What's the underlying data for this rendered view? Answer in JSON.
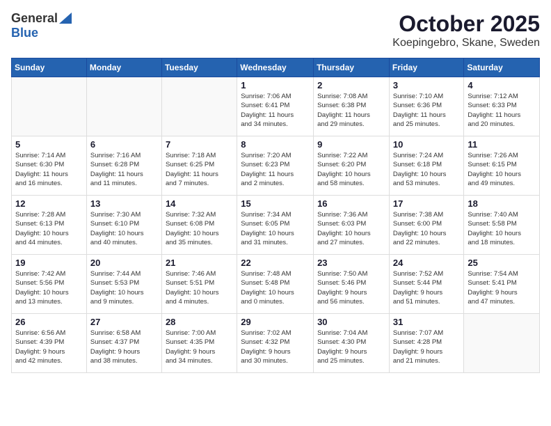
{
  "header": {
    "logo_general": "General",
    "logo_blue": "Blue",
    "month": "October 2025",
    "location": "Koepingebro, Skane, Sweden"
  },
  "weekdays": [
    "Sunday",
    "Monday",
    "Tuesday",
    "Wednesday",
    "Thursday",
    "Friday",
    "Saturday"
  ],
  "weeks": [
    [
      {
        "day": "",
        "info": ""
      },
      {
        "day": "",
        "info": ""
      },
      {
        "day": "",
        "info": ""
      },
      {
        "day": "1",
        "info": "Sunrise: 7:06 AM\nSunset: 6:41 PM\nDaylight: 11 hours\nand 34 minutes."
      },
      {
        "day": "2",
        "info": "Sunrise: 7:08 AM\nSunset: 6:38 PM\nDaylight: 11 hours\nand 29 minutes."
      },
      {
        "day": "3",
        "info": "Sunrise: 7:10 AM\nSunset: 6:36 PM\nDaylight: 11 hours\nand 25 minutes."
      },
      {
        "day": "4",
        "info": "Sunrise: 7:12 AM\nSunset: 6:33 PM\nDaylight: 11 hours\nand 20 minutes."
      }
    ],
    [
      {
        "day": "5",
        "info": "Sunrise: 7:14 AM\nSunset: 6:30 PM\nDaylight: 11 hours\nand 16 minutes."
      },
      {
        "day": "6",
        "info": "Sunrise: 7:16 AM\nSunset: 6:28 PM\nDaylight: 11 hours\nand 11 minutes."
      },
      {
        "day": "7",
        "info": "Sunrise: 7:18 AM\nSunset: 6:25 PM\nDaylight: 11 hours\nand 7 minutes."
      },
      {
        "day": "8",
        "info": "Sunrise: 7:20 AM\nSunset: 6:23 PM\nDaylight: 11 hours\nand 2 minutes."
      },
      {
        "day": "9",
        "info": "Sunrise: 7:22 AM\nSunset: 6:20 PM\nDaylight: 10 hours\nand 58 minutes."
      },
      {
        "day": "10",
        "info": "Sunrise: 7:24 AM\nSunset: 6:18 PM\nDaylight: 10 hours\nand 53 minutes."
      },
      {
        "day": "11",
        "info": "Sunrise: 7:26 AM\nSunset: 6:15 PM\nDaylight: 10 hours\nand 49 minutes."
      }
    ],
    [
      {
        "day": "12",
        "info": "Sunrise: 7:28 AM\nSunset: 6:13 PM\nDaylight: 10 hours\nand 44 minutes."
      },
      {
        "day": "13",
        "info": "Sunrise: 7:30 AM\nSunset: 6:10 PM\nDaylight: 10 hours\nand 40 minutes."
      },
      {
        "day": "14",
        "info": "Sunrise: 7:32 AM\nSunset: 6:08 PM\nDaylight: 10 hours\nand 35 minutes."
      },
      {
        "day": "15",
        "info": "Sunrise: 7:34 AM\nSunset: 6:05 PM\nDaylight: 10 hours\nand 31 minutes."
      },
      {
        "day": "16",
        "info": "Sunrise: 7:36 AM\nSunset: 6:03 PM\nDaylight: 10 hours\nand 27 minutes."
      },
      {
        "day": "17",
        "info": "Sunrise: 7:38 AM\nSunset: 6:00 PM\nDaylight: 10 hours\nand 22 minutes."
      },
      {
        "day": "18",
        "info": "Sunrise: 7:40 AM\nSunset: 5:58 PM\nDaylight: 10 hours\nand 18 minutes."
      }
    ],
    [
      {
        "day": "19",
        "info": "Sunrise: 7:42 AM\nSunset: 5:56 PM\nDaylight: 10 hours\nand 13 minutes."
      },
      {
        "day": "20",
        "info": "Sunrise: 7:44 AM\nSunset: 5:53 PM\nDaylight: 10 hours\nand 9 minutes."
      },
      {
        "day": "21",
        "info": "Sunrise: 7:46 AM\nSunset: 5:51 PM\nDaylight: 10 hours\nand 4 minutes."
      },
      {
        "day": "22",
        "info": "Sunrise: 7:48 AM\nSunset: 5:48 PM\nDaylight: 10 hours\nand 0 minutes."
      },
      {
        "day": "23",
        "info": "Sunrise: 7:50 AM\nSunset: 5:46 PM\nDaylight: 9 hours\nand 56 minutes."
      },
      {
        "day": "24",
        "info": "Sunrise: 7:52 AM\nSunset: 5:44 PM\nDaylight: 9 hours\nand 51 minutes."
      },
      {
        "day": "25",
        "info": "Sunrise: 7:54 AM\nSunset: 5:41 PM\nDaylight: 9 hours\nand 47 minutes."
      }
    ],
    [
      {
        "day": "26",
        "info": "Sunrise: 6:56 AM\nSunset: 4:39 PM\nDaylight: 9 hours\nand 42 minutes."
      },
      {
        "day": "27",
        "info": "Sunrise: 6:58 AM\nSunset: 4:37 PM\nDaylight: 9 hours\nand 38 minutes."
      },
      {
        "day": "28",
        "info": "Sunrise: 7:00 AM\nSunset: 4:35 PM\nDaylight: 9 hours\nand 34 minutes."
      },
      {
        "day": "29",
        "info": "Sunrise: 7:02 AM\nSunset: 4:32 PM\nDaylight: 9 hours\nand 30 minutes."
      },
      {
        "day": "30",
        "info": "Sunrise: 7:04 AM\nSunset: 4:30 PM\nDaylight: 9 hours\nand 25 minutes."
      },
      {
        "day": "31",
        "info": "Sunrise: 7:07 AM\nSunset: 4:28 PM\nDaylight: 9 hours\nand 21 minutes."
      },
      {
        "day": "",
        "info": ""
      }
    ]
  ]
}
